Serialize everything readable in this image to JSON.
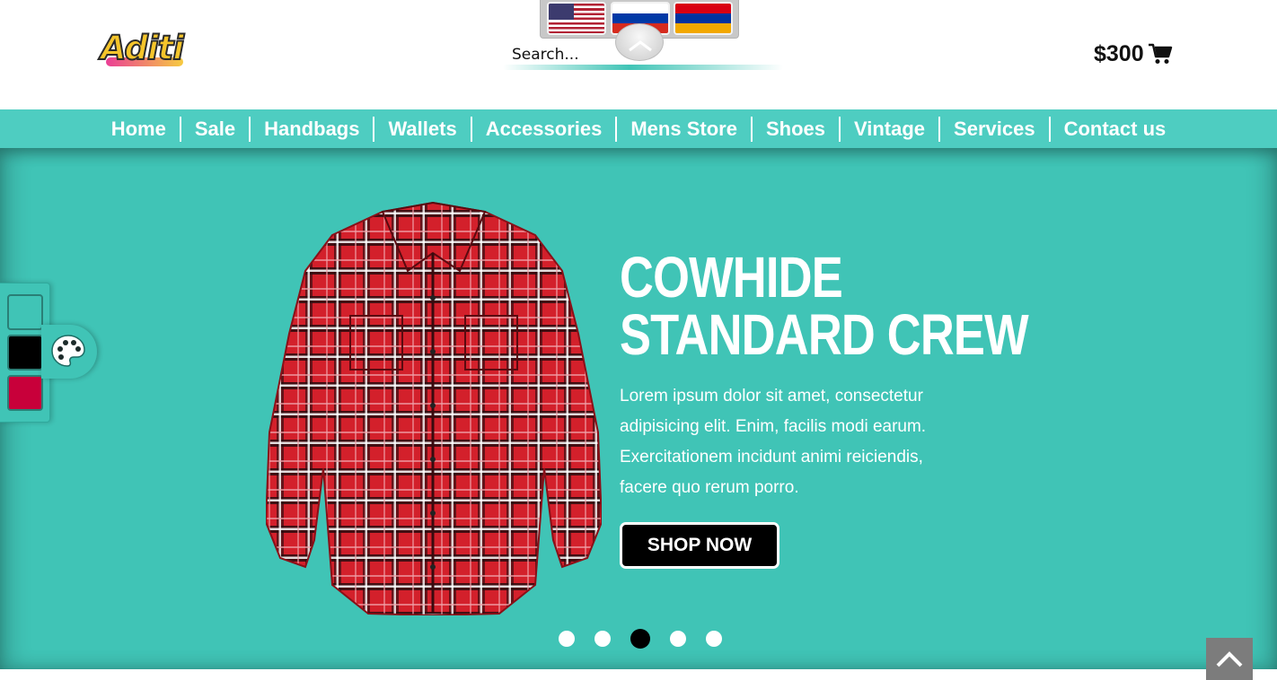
{
  "header": {
    "logo_text": "Aditi",
    "search_placeholder": "Search...",
    "cart_total": "$300",
    "cart_icon": "shopping-cart-icon",
    "languages": [
      "English",
      "Russian",
      "Armenian"
    ]
  },
  "nav": {
    "items": [
      "Home",
      "Sale",
      "Handbags",
      "Wallets",
      "Accessories",
      "Mens Store",
      "Shoes",
      "Vintage",
      "Services",
      "Contact us"
    ]
  },
  "hero": {
    "title_line1": "COWHIDE",
    "title_line2": "STANDARD CREW",
    "text": "Lorem ipsum dolor sit amet, consectetur adipisicing elit. Enim, facilis modi earum. Exercitationem incidunt animi reiciendis, facere quo rerum porro.",
    "button_label": "SHOP NOW",
    "slides_total": 5,
    "active_slide": 3
  },
  "theme_picker": {
    "swatches": [
      "#40c4b6",
      "#000000",
      "#c8003a"
    ],
    "icon": "palette-icon"
  },
  "colors": {
    "accent": "#40c4b6",
    "nav": "#4ecdc1",
    "cart_text": "#111111"
  },
  "scroll_top_icon": "chevron-up-icon"
}
